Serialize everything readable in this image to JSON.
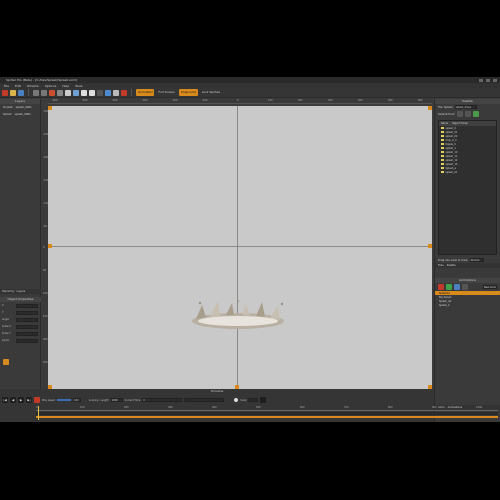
{
  "app": {
    "title": "Spriter Pro (Beta) - [C:/Dev/Splash/Splash.scml]",
    "menu": [
      "File",
      "Edit",
      "Window",
      "Options",
      "Help",
      "Tools"
    ],
    "toolbar": {
      "animated_btn": "Animated",
      "scale_btn": "Full Screen",
      "snap_btn": "Snap Grid",
      "zoom_label": "Zoom",
      "lock_label": "Lock Sprites"
    }
  },
  "rulers": {
    "top": [
      "-600",
      "-500",
      "-400",
      "-300",
      "-200",
      "-100",
      "0",
      "100",
      "200",
      "300",
      "400",
      "500",
      "600"
    ],
    "left": [
      "-300",
      "-250",
      "-200",
      "-150",
      "-100",
      "-50",
      "0",
      "50",
      "100",
      "150",
      "200",
      "250"
    ]
  },
  "left_panel": {
    "header": "Layers",
    "rows": [
      {
        "name": "Droplet",
        "value": "splash_0001"
      },
      {
        "name": "Splash",
        "value": "splash_0002"
      }
    ],
    "tabs": [
      "Hierarchy",
      "Layers"
    ],
    "props_header": "Object Properties",
    "props": [
      "X",
      "Y",
      "Angle",
      "Scale X",
      "Scale Y",
      "Alpha"
    ]
  },
  "right_panel": {
    "palette_header": "Palette",
    "file_label": "File: Splash",
    "palette_dropdown": "splash_drops",
    "sprite_label": "Default Pivot",
    "list_header": [
      "Name",
      "Object Folder"
    ],
    "items": [
      "splash_0",
      "splash_01",
      "splash_02",
      "drop_0_d",
      "Ripple_0",
      "splash_1",
      "splash_10",
      "splash_11",
      "splash_12",
      "splash_13",
      "Splash_a",
      "splash_01"
    ],
    "draw_label": "Drag into view to draw",
    "draw_value": "Normal",
    "tabs": [
      "Files",
      "Palette"
    ],
    "anim_header": "Animations",
    "anim_new": "New Anim",
    "animations": [
      {
        "name": "Splash01",
        "selected": true
      },
      {
        "name": "Big Splash",
        "selected": false
      },
      {
        "name": "Splash_alt",
        "selected": false
      },
      {
        "name": "Splash_b",
        "selected": false
      }
    ],
    "bottom_tabs": [
      "Anim",
      "Animations"
    ]
  },
  "timeline": {
    "header": "Timeline",
    "speed_label": "Play speed",
    "speed_value": "100",
    "length_label": "Length",
    "length_value": "1000",
    "loop_label": "Looping",
    "current_time_label": "Current Time",
    "current_time_value": "0",
    "snapping_label": "Snap",
    "ruler": [
      "0",
      "100",
      "200",
      "300",
      "400",
      "500",
      "600",
      "700",
      "800",
      "900",
      "1000"
    ]
  },
  "colors": {
    "accent": "#d98a1c",
    "canvas": "#c9c9c9",
    "panel": "#3a3a3a"
  }
}
